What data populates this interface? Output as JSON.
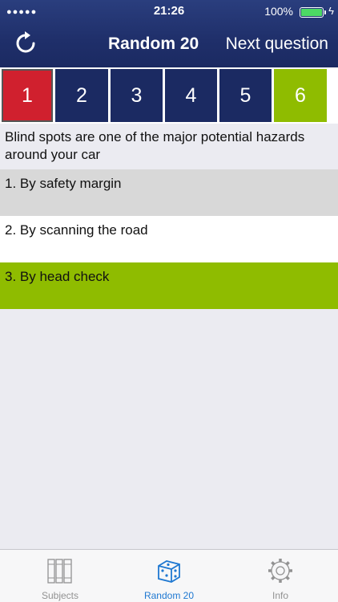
{
  "status": {
    "signal": "●●●●●",
    "time": "21:26",
    "battery": "100%"
  },
  "nav": {
    "title": "Random 20",
    "next_label": "Next question"
  },
  "question_tabs": [
    {
      "label": "1",
      "color": "#d0202e",
      "current": true
    },
    {
      "label": "2",
      "color": "#1b2a62"
    },
    {
      "label": "3",
      "color": "#1b2a62"
    },
    {
      "label": "4",
      "color": "#1b2a62"
    },
    {
      "label": "5",
      "color": "#1b2a62"
    },
    {
      "label": "6",
      "color": "#8fbc00"
    }
  ],
  "question": "Blind spots are one of the major potential hazards around your car",
  "answers": [
    {
      "label": "1. By safety margin",
      "color": "#d8d8d8"
    },
    {
      "label": "2. By scanning the road",
      "color": "#ffffff"
    },
    {
      "label": "3. By head check",
      "color": "#8fbc00"
    }
  ],
  "tabbar": [
    {
      "label": "Subjects",
      "icon": "books-icon"
    },
    {
      "label": "Random 20",
      "icon": "dice-icon",
      "active": true
    },
    {
      "label": "Info",
      "icon": "gear-icon"
    }
  ],
  "colors": {
    "nav": "#1f2f6a",
    "active": "#1f78d1",
    "correct": "#8fbc00",
    "wrong": "#d0202e"
  }
}
